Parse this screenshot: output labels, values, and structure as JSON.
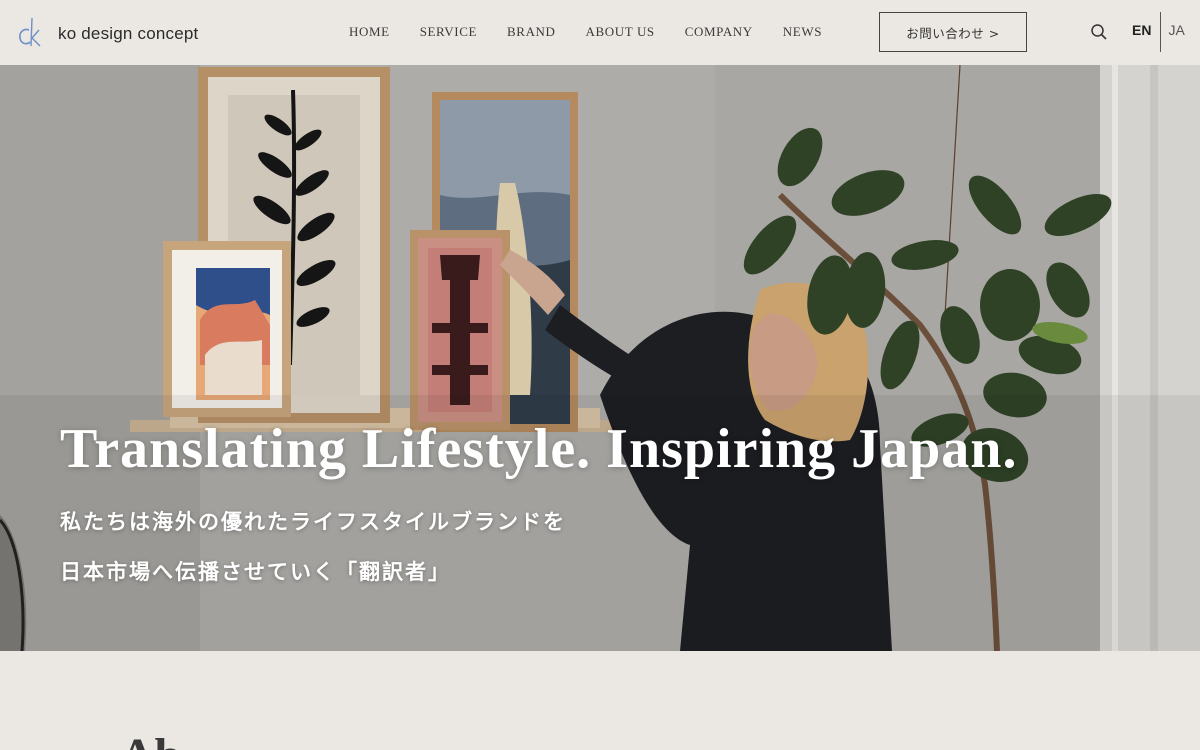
{
  "brand": {
    "name": "ko design concept",
    "logo_icon": "ck-monogram-logo"
  },
  "nav": {
    "items": [
      {
        "label": "HOME"
      },
      {
        "label": "SERVICE"
      },
      {
        "label": "BRAND"
      },
      {
        "label": "ABOUT US"
      },
      {
        "label": "COMPANY"
      },
      {
        "label": "NEWS"
      }
    ]
  },
  "contact": {
    "label": "お問い合わせ >"
  },
  "search": {
    "icon": "search-icon"
  },
  "language": {
    "active": "EN",
    "other": "JA"
  },
  "hero": {
    "title": "Translating Lifestyle. Inspiring Japan.",
    "subtitle_line1": "私たちは海外の優れたライフスタイルブランドを",
    "subtitle_line2": "日本市場へ伝播させていく「翻訳者」"
  },
  "section": {
    "heading_partial": "Ab"
  },
  "colors": {
    "background": "#ebe8e3",
    "text": "#333333",
    "hero_text": "#ffffff"
  }
}
